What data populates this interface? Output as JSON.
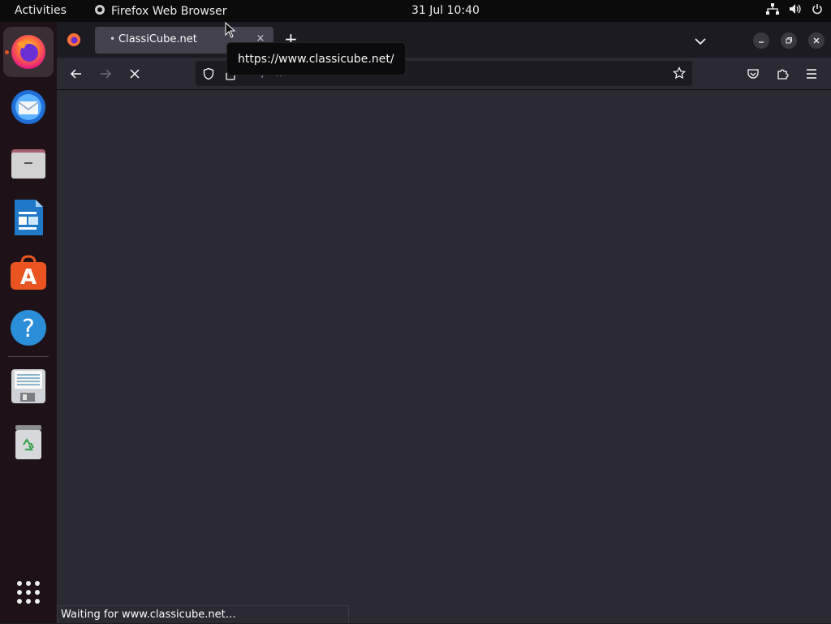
{
  "topbar": {
    "activities": "Activities",
    "app_name": "Firefox Web Browser",
    "clock": "31 Jul  10:40",
    "tray_icons": [
      "network-icon",
      "volume-icon",
      "power-icon"
    ]
  },
  "dock": {
    "items": [
      {
        "name": "firefox",
        "icon": "firefox-icon",
        "running": true
      },
      {
        "name": "thunderbird",
        "icon": "mail-icon",
        "running": false
      },
      {
        "name": "files",
        "icon": "folder-icon",
        "running": false
      },
      {
        "name": "libreoffice-writer",
        "icon": "writer-icon",
        "running": false
      },
      {
        "name": "ubuntu-software",
        "icon": "software-store-icon",
        "running": false
      },
      {
        "name": "help",
        "icon": "help-icon",
        "running": false
      },
      {
        "name": "save-drive",
        "icon": "floppy-icon",
        "running": false
      },
      {
        "name": "trash",
        "icon": "trash-icon",
        "running": false
      }
    ],
    "show_apps_icon": "grid-icon"
  },
  "browser": {
    "tab": {
      "title": "ClassiCube.net",
      "loading_dot": "•",
      "close": "×"
    },
    "new_tab": "+",
    "url": "https://www.classicube.net",
    "tooltip": "https://www.classicube.net/",
    "status": "Waiting for www.classicube.net…"
  },
  "colors": {
    "accent": "#e95420",
    "window_bg": "#2b2a33",
    "tabstrip_bg": "#1c1b22",
    "topbar_bg": "#0b0b0b",
    "dock_bg": "#1e1218"
  }
}
